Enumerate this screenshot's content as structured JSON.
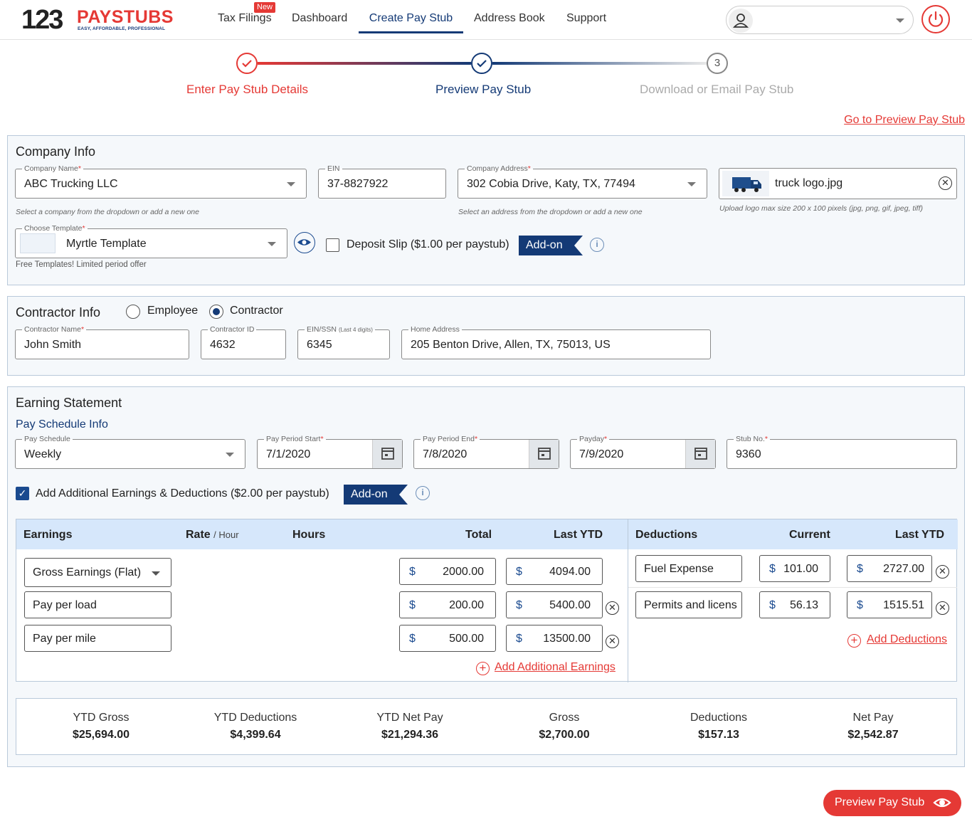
{
  "brand": {
    "num": "123",
    "word": "PAYSTUBS",
    "tag": "EASY, AFFORDABLE, PROFESSIONAL"
  },
  "nav": {
    "tax_filings": "Tax Filings",
    "new_badge": "New",
    "dashboard": "Dashboard",
    "create": "Create Pay Stub",
    "address_book": "Address Book",
    "support": "Support"
  },
  "user": {
    "name": ""
  },
  "steps": {
    "s1": "Enter Pay Stub Details",
    "s2": "Preview Pay Stub",
    "s3": "Download or Email Pay Stub",
    "s3_num": "3"
  },
  "goto_preview": "Go to Preview Pay Stub",
  "company": {
    "title": "Company Info",
    "name_label": "Company Name",
    "name": "ABC Trucking LLC",
    "name_hint": "Select a company from the dropdown or add a new one",
    "ein_label": "EIN",
    "ein": "37-8827922",
    "address_label": "Company Address",
    "address": "302 Cobia Drive, Katy, TX, 77494",
    "address_hint": "Select an address from the dropdown or add a new one",
    "logo_file": "truck logo.jpg",
    "logo_hint": "Upload logo max size 200 x 100 pixels (jpg, png, gif, jpeg, tiff)",
    "template_label": "Choose Template",
    "template": "Myrtle Template",
    "template_hint": "Free Templates! Limited period offer",
    "deposit_label": "Deposit Slip ($1.00 per paystub)",
    "addon": "Add-on"
  },
  "contractor": {
    "title": "Contractor Info",
    "employee": "Employee",
    "contractor": "Contractor",
    "name_label": "Contractor Name",
    "name": "John Smith",
    "id_label": "Contractor ID",
    "id": "4632",
    "ssn_label": "EIN/SSN",
    "ssn_small": "(Last 4 digits)",
    "ssn": "6345",
    "home_label": "Home Address",
    "home": "205 Benton Drive, Allen, TX, 75013, US"
  },
  "earning": {
    "title": "Earning Statement",
    "schedule_title": "Pay Schedule Info",
    "schedule_label": "Pay Schedule",
    "schedule": "Weekly",
    "start_label": "Pay Period Start",
    "start": "7/1/2020",
    "end_label": "Pay Period End",
    "end": "7/8/2020",
    "payday_label": "Payday",
    "payday": "7/9/2020",
    "stub_label": "Stub No.",
    "stub": "9360",
    "additional_label": "Add Additional Earnings & Deductions ($2.00 per paystub)",
    "addon": "Add-on",
    "headers": {
      "earnings": "Earnings",
      "rate": "Rate",
      "per_hour": "/ Hour",
      "hours": "Hours",
      "total": "Total",
      "last_ytd": "Last YTD",
      "deductions": "Deductions",
      "current": "Current",
      "ded_last_ytd": "Last YTD"
    },
    "rows": [
      {
        "name": "Gross Earnings (Flat)",
        "total": "2000.00",
        "ytd": "4094.00"
      },
      {
        "name": "Pay per load",
        "total": "200.00",
        "ytd": "5400.00"
      },
      {
        "name": "Pay per mile",
        "total": "500.00",
        "ytd": "13500.00"
      }
    ],
    "deductions": [
      {
        "name": "Fuel Expense",
        "current": "101.00",
        "ytd": "2727.00"
      },
      {
        "name": "Permits and licens",
        "current": "56.13",
        "ytd": "1515.51"
      }
    ],
    "add_earnings": "Add Additional Earnings",
    "add_deductions": "Add Deductions",
    "currency": "$"
  },
  "summary": {
    "ytd_gross_label": "YTD Gross",
    "ytd_gross": "$25,694.00",
    "ytd_ded_label": "YTD Deductions",
    "ytd_ded": "$4,399.64",
    "ytd_net_label": "YTD Net Pay",
    "ytd_net": "$21,294.36",
    "gross_label": "Gross",
    "gross": "$2,700.00",
    "ded_label": "Deductions",
    "ded": "$157.13",
    "net_label": "Net Pay",
    "net": "$2,542.87"
  },
  "preview_button": "Preview Pay Stub",
  "colors": {
    "brand_red": "#e53935",
    "brand_navy": "#143a76",
    "header_blue": "#d6e7fb"
  }
}
